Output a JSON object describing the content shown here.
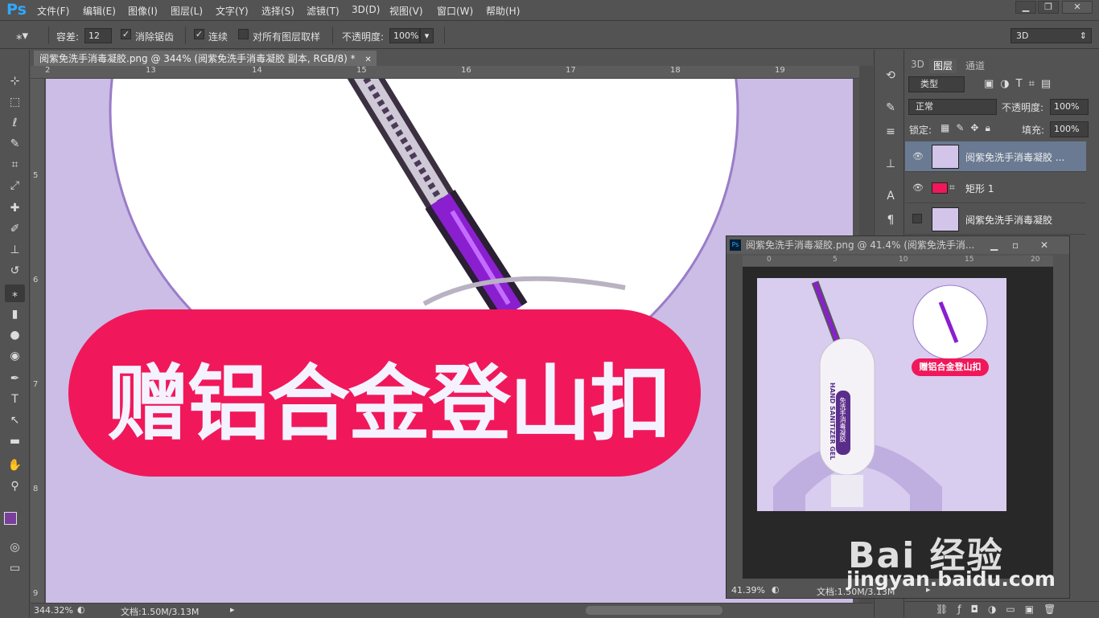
{
  "menubar": {
    "logo": "Ps",
    "items": [
      "文件(F)",
      "编辑(E)",
      "图像(I)",
      "图层(L)",
      "文字(Y)",
      "选择(S)",
      "滤镜(T)",
      "3D(D)",
      "视图(V)",
      "窗口(W)",
      "帮助(H)"
    ]
  },
  "options": {
    "tolerance_label": "容差:",
    "tolerance_value": "12",
    "antialias_label": "消除锯齿",
    "contiguous_label": "连续",
    "sample_all_label": "对所有图层取样",
    "opacity_label": "不透明度:",
    "opacity_value": "100%",
    "workspace": "3D"
  },
  "document": {
    "tab_title": "阅紫免洗手消毒凝胶.png @ 344% (阅紫免洗手消毒凝胶 副本, RGB/8) *",
    "ruler_top": [
      "2",
      "13",
      "14",
      "15",
      "16",
      "17",
      "18",
      "19"
    ],
    "ruler_left": [
      "5",
      "6",
      "7",
      "8",
      "9"
    ],
    "banner_text": "赠铝合金登山扣",
    "zoom": "344.32%",
    "doc_size": "文档:1.50M/3.13M"
  },
  "panels": {
    "tabs": [
      "3D",
      "图层",
      "通道"
    ],
    "filter_kind": "类型",
    "blend_mode": "正常",
    "opacity_label": "不透明度:",
    "opacity_value": "100%",
    "lock_label": "锁定:",
    "fill_label": "填充:",
    "fill_value": "100%",
    "layers": [
      {
        "name": "阅紫免洗手消毒凝胶 ...",
        "visible": true,
        "selected": true
      },
      {
        "name": "矩形 1",
        "visible": true,
        "selected": false
      },
      {
        "name": "阅紫免洗手消毒凝胶",
        "visible": false,
        "selected": false
      }
    ]
  },
  "nav_window": {
    "title": "阅紫免洗手消毒凝胶.png @ 41.4% (阅紫免洗手消...",
    "ruler": [
      "0",
      "5",
      "10",
      "15",
      "20"
    ],
    "bottle_label": "HAND SANITIZER GEL",
    "bottle_cn": "免洗手消毒凝胶",
    "banner": "赠铝合金登山扣",
    "zoom": "41.39%",
    "doc_size": "文档:1.50M/3.13M"
  },
  "watermark": {
    "brand": "Bai 经验",
    "url": "jingyan.baidu.com"
  },
  "colors": {
    "accent_pink": "#f0185a",
    "canvas_bg": "#cbbde6",
    "fg_color": "#7a3e9c",
    "bg_color": "#ffffff"
  }
}
